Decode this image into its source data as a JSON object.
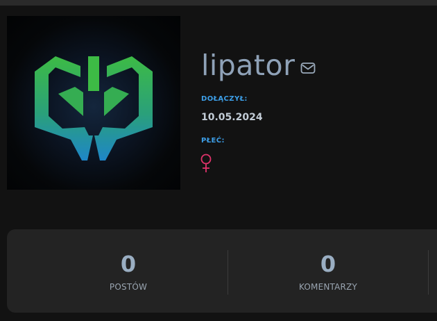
{
  "profile": {
    "username": "lipator",
    "icons": {
      "message": "mail-icon",
      "gender": "female-sign-icon",
      "avatar": "shield-logo-avatar"
    },
    "joined_label": "DOŁĄCZYŁ:",
    "joined_value": "10.05.2024",
    "gender_label": "PŁEĆ:",
    "gender_symbol": "♀"
  },
  "stats": [
    {
      "value": "0",
      "label": "POSTÓW"
    },
    {
      "value": "0",
      "label": "KOMENTARZY"
    }
  ],
  "colors": {
    "background": "#121212",
    "card": "#232323",
    "label_accent": "#3d9fe8",
    "username": "#8fa2b8",
    "gender_female": "#e2336b",
    "logo_gradient_top": "#38b84a",
    "logo_gradient_bottom": "#1f88c9"
  }
}
